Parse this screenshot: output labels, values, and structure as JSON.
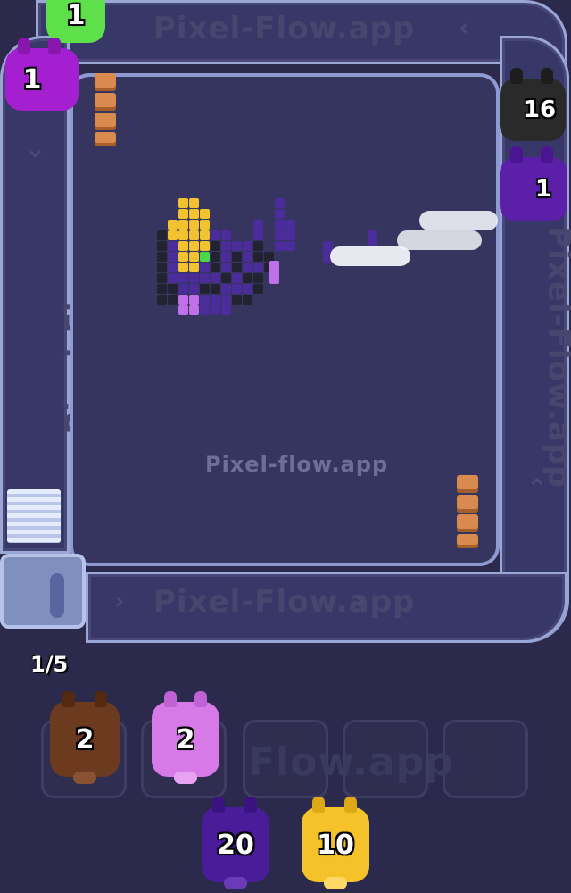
{
  "watermark": {
    "center": "Pixel-flow.app",
    "track_top": "Pixel-Flow.app",
    "track_bottom": "Pixel-Flow.app",
    "track_right": "Pixel-Flow.app",
    "track_left": "Pixel-Flow.app",
    "slots": "Flow.app"
  },
  "conveyor": {
    "queue_progress": "1/5"
  },
  "track_pigs": [
    {
      "label": "1",
      "color": "#5ee04a"
    },
    {
      "label": "1",
      "color": "#a41fcf"
    },
    {
      "label": "16",
      "color": "#2a2a2a"
    },
    {
      "label": "1",
      "color": "#5b1fa8"
    }
  ],
  "holding_slots": {
    "count": 5,
    "pigs": [
      {
        "label": "2",
        "color": "#6b3a1f"
      },
      {
        "label": "2",
        "color": "#d77ae8"
      }
    ]
  },
  "queue_pigs": [
    {
      "label": "20",
      "color": "#4a1c9a"
    },
    {
      "label": "10",
      "color": "#f5c22a"
    }
  ],
  "colors": {
    "background": "#2b2a4c",
    "board": "#363560",
    "rail": "#a9b4e0"
  }
}
